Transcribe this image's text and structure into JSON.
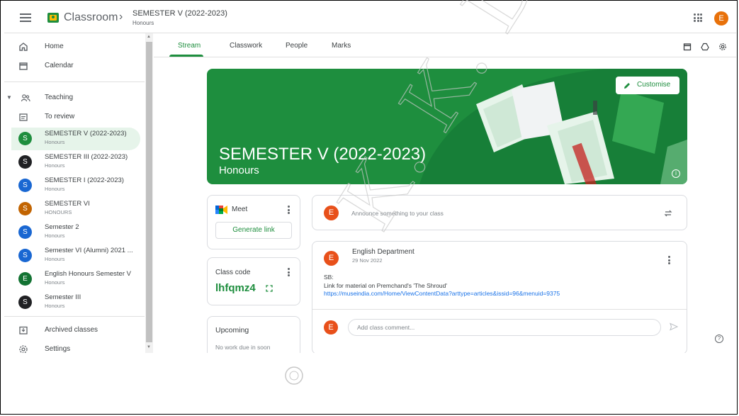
{
  "header": {
    "app_title": "Classroom",
    "breadcrumb_title": "SEMESTER V (2022-2023)",
    "breadcrumb_subtitle": "Honours",
    "avatar_letter": "E"
  },
  "sidebar": {
    "home": "Home",
    "calendar": "Calendar",
    "teaching": "Teaching",
    "to_review": "To review",
    "classes": [
      {
        "letter": "S",
        "title": "SEMESTER V (2022-2023)",
        "subtitle": "Honours",
        "color": "#1e8e3e"
      },
      {
        "letter": "S",
        "title": "SEMESTER III (2022-2023)",
        "subtitle": "Honours",
        "color": "#202124"
      },
      {
        "letter": "S",
        "title": "SEMESTER I (2022-2023)",
        "subtitle": "Honours",
        "color": "#1967d2"
      },
      {
        "letter": "S",
        "title": "SEMESTER VI",
        "subtitle": "HONOURS",
        "color": "#c26401"
      },
      {
        "letter": "S",
        "title": "Semester 2",
        "subtitle": "Honours",
        "color": "#1967d2"
      },
      {
        "letter": "S",
        "title": "Semester VI (Alumni) 2021 ...",
        "subtitle": "Honours",
        "color": "#1967d2"
      },
      {
        "letter": "E",
        "title": "English Honours Semester V",
        "subtitle": "Honours",
        "color": "#137333"
      },
      {
        "letter": "S",
        "title": "Semester III",
        "subtitle": "Honours",
        "color": "#202124"
      }
    ],
    "archived": "Archived classes",
    "settings": "Settings"
  },
  "tabs": [
    "Stream",
    "Classwork",
    "People",
    "Marks"
  ],
  "banner": {
    "title": "SEMESTER V (2022-2023)",
    "subtitle": "Honours",
    "customise_label": "Customise",
    "color": "#1e8e3e"
  },
  "meet": {
    "label": "Meet",
    "generate_label": "Generate link"
  },
  "class_code": {
    "label": "Class code",
    "value": "lhfqmz4"
  },
  "upcoming": {
    "label": "Upcoming",
    "empty_text": "No work due in soon"
  },
  "announce": {
    "avatar_letter": "E",
    "placeholder": "Announce something to your class"
  },
  "post": {
    "avatar_letter": "E",
    "author": "English Department",
    "date": "29 Nov 2022",
    "line1": "SB:",
    "line2": "Link for material on Premchand's 'The Shroud'",
    "link": "https://museindia.com/Home/ViewContentData?arttype=articles&issid=96&menuid=9375",
    "comment_avatar": "E",
    "comment_placeholder": "Add class comment..."
  },
  "colors": {
    "accent": "#1e8e3e",
    "avatar_orange": "#e8501a",
    "link": "#1a73e8"
  },
  "watermark": "K. K. DAS COLLEGE"
}
